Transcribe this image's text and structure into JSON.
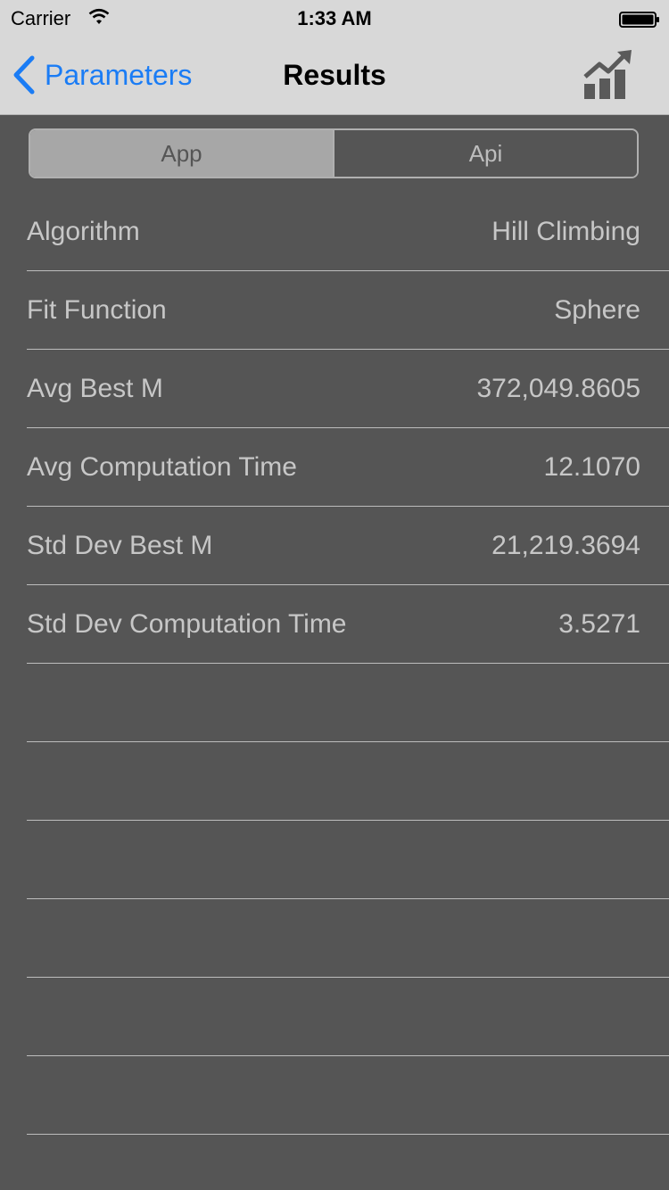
{
  "status_bar": {
    "carrier": "Carrier",
    "time": "1:33 AM"
  },
  "nav": {
    "back_label": "Parameters",
    "title": "Results",
    "chart_icon": "chart-growth-icon"
  },
  "segments": [
    {
      "label": "App",
      "selected": true
    },
    {
      "label": "Api",
      "selected": false
    }
  ],
  "rows": [
    {
      "label": "Algorithm",
      "value": "Hill Climbing"
    },
    {
      "label": "Fit Function",
      "value": "Sphere"
    },
    {
      "label": "Avg Best M",
      "value": "372,049.8605"
    },
    {
      "label": "Avg Computation Time",
      "value": "12.1070"
    },
    {
      "label": "Std Dev Best M",
      "value": "21,219.3694"
    },
    {
      "label": "Std Dev Computation Time",
      "value": "3.5271"
    },
    {
      "label": "",
      "value": ""
    },
    {
      "label": "",
      "value": ""
    },
    {
      "label": "",
      "value": ""
    },
    {
      "label": "",
      "value": ""
    },
    {
      "label": "",
      "value": ""
    },
    {
      "label": "",
      "value": ""
    }
  ],
  "colors": {
    "accent": "#1a7cf5",
    "background": "#555555",
    "nav_bar": "#d8d8d8",
    "text": "#c7c7c7"
  }
}
